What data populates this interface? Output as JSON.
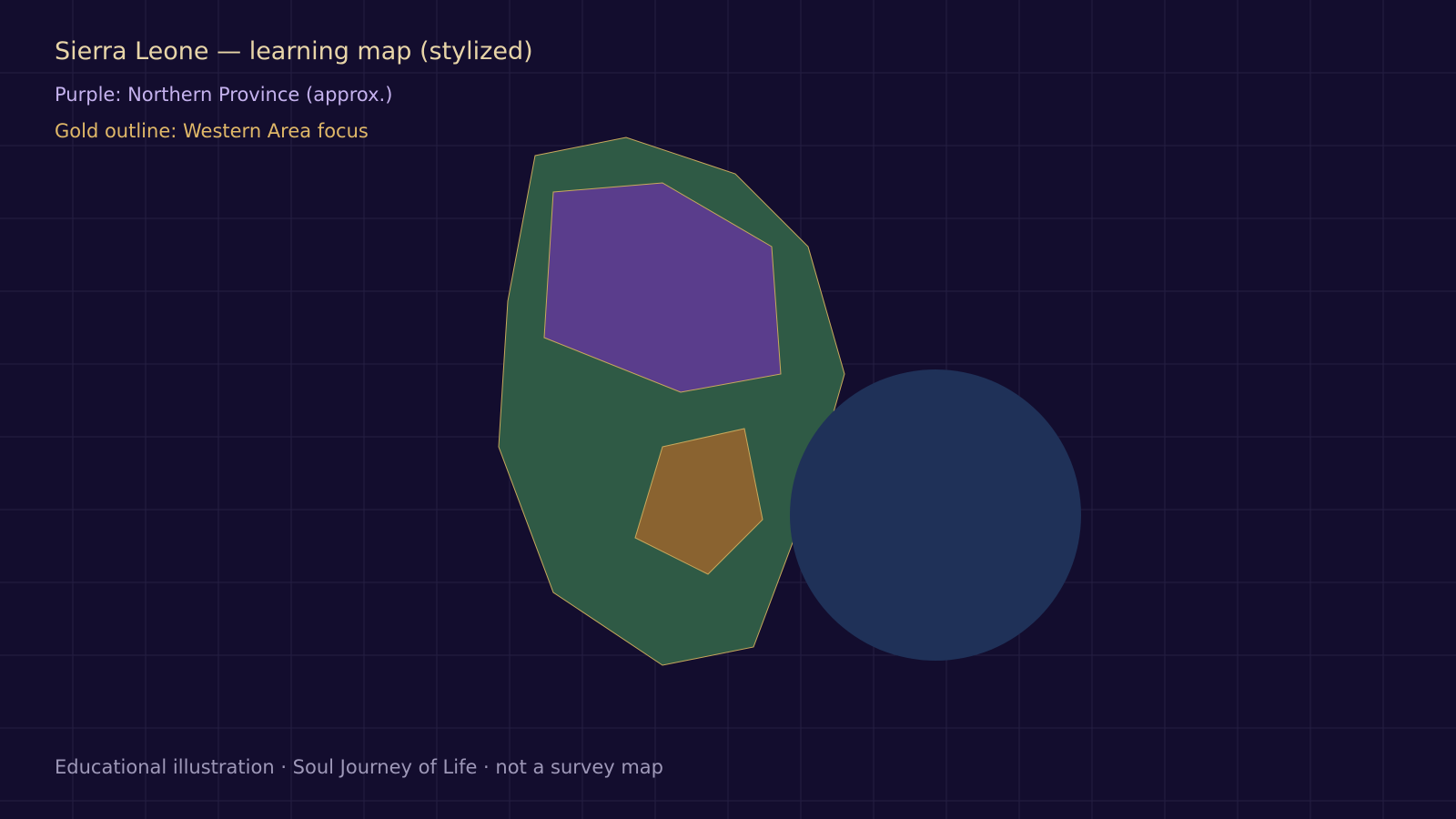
{
  "map": {
    "title": "Sierra Leone — learning map (stylized)",
    "legend": {
      "northern": "Purple: Northern Province (approx.)",
      "western": "Gold outline: Western Area focus"
    },
    "footer": "Educational illustration · Soul Journey of Life · not a survey map"
  },
  "colors": {
    "background": "#130d2e",
    "grid": "#241f42",
    "country_fill": "#2f5a45",
    "northern_fill": "#5a3d8c",
    "western_fill": "#8a6330",
    "outline_gold": "#c9a95c",
    "ocean_circle": "#1f3158",
    "title": "#e8d5a8",
    "legend_purple": "#c5b2ee",
    "legend_gold": "#e0b868",
    "footer": "#9e98b8"
  }
}
